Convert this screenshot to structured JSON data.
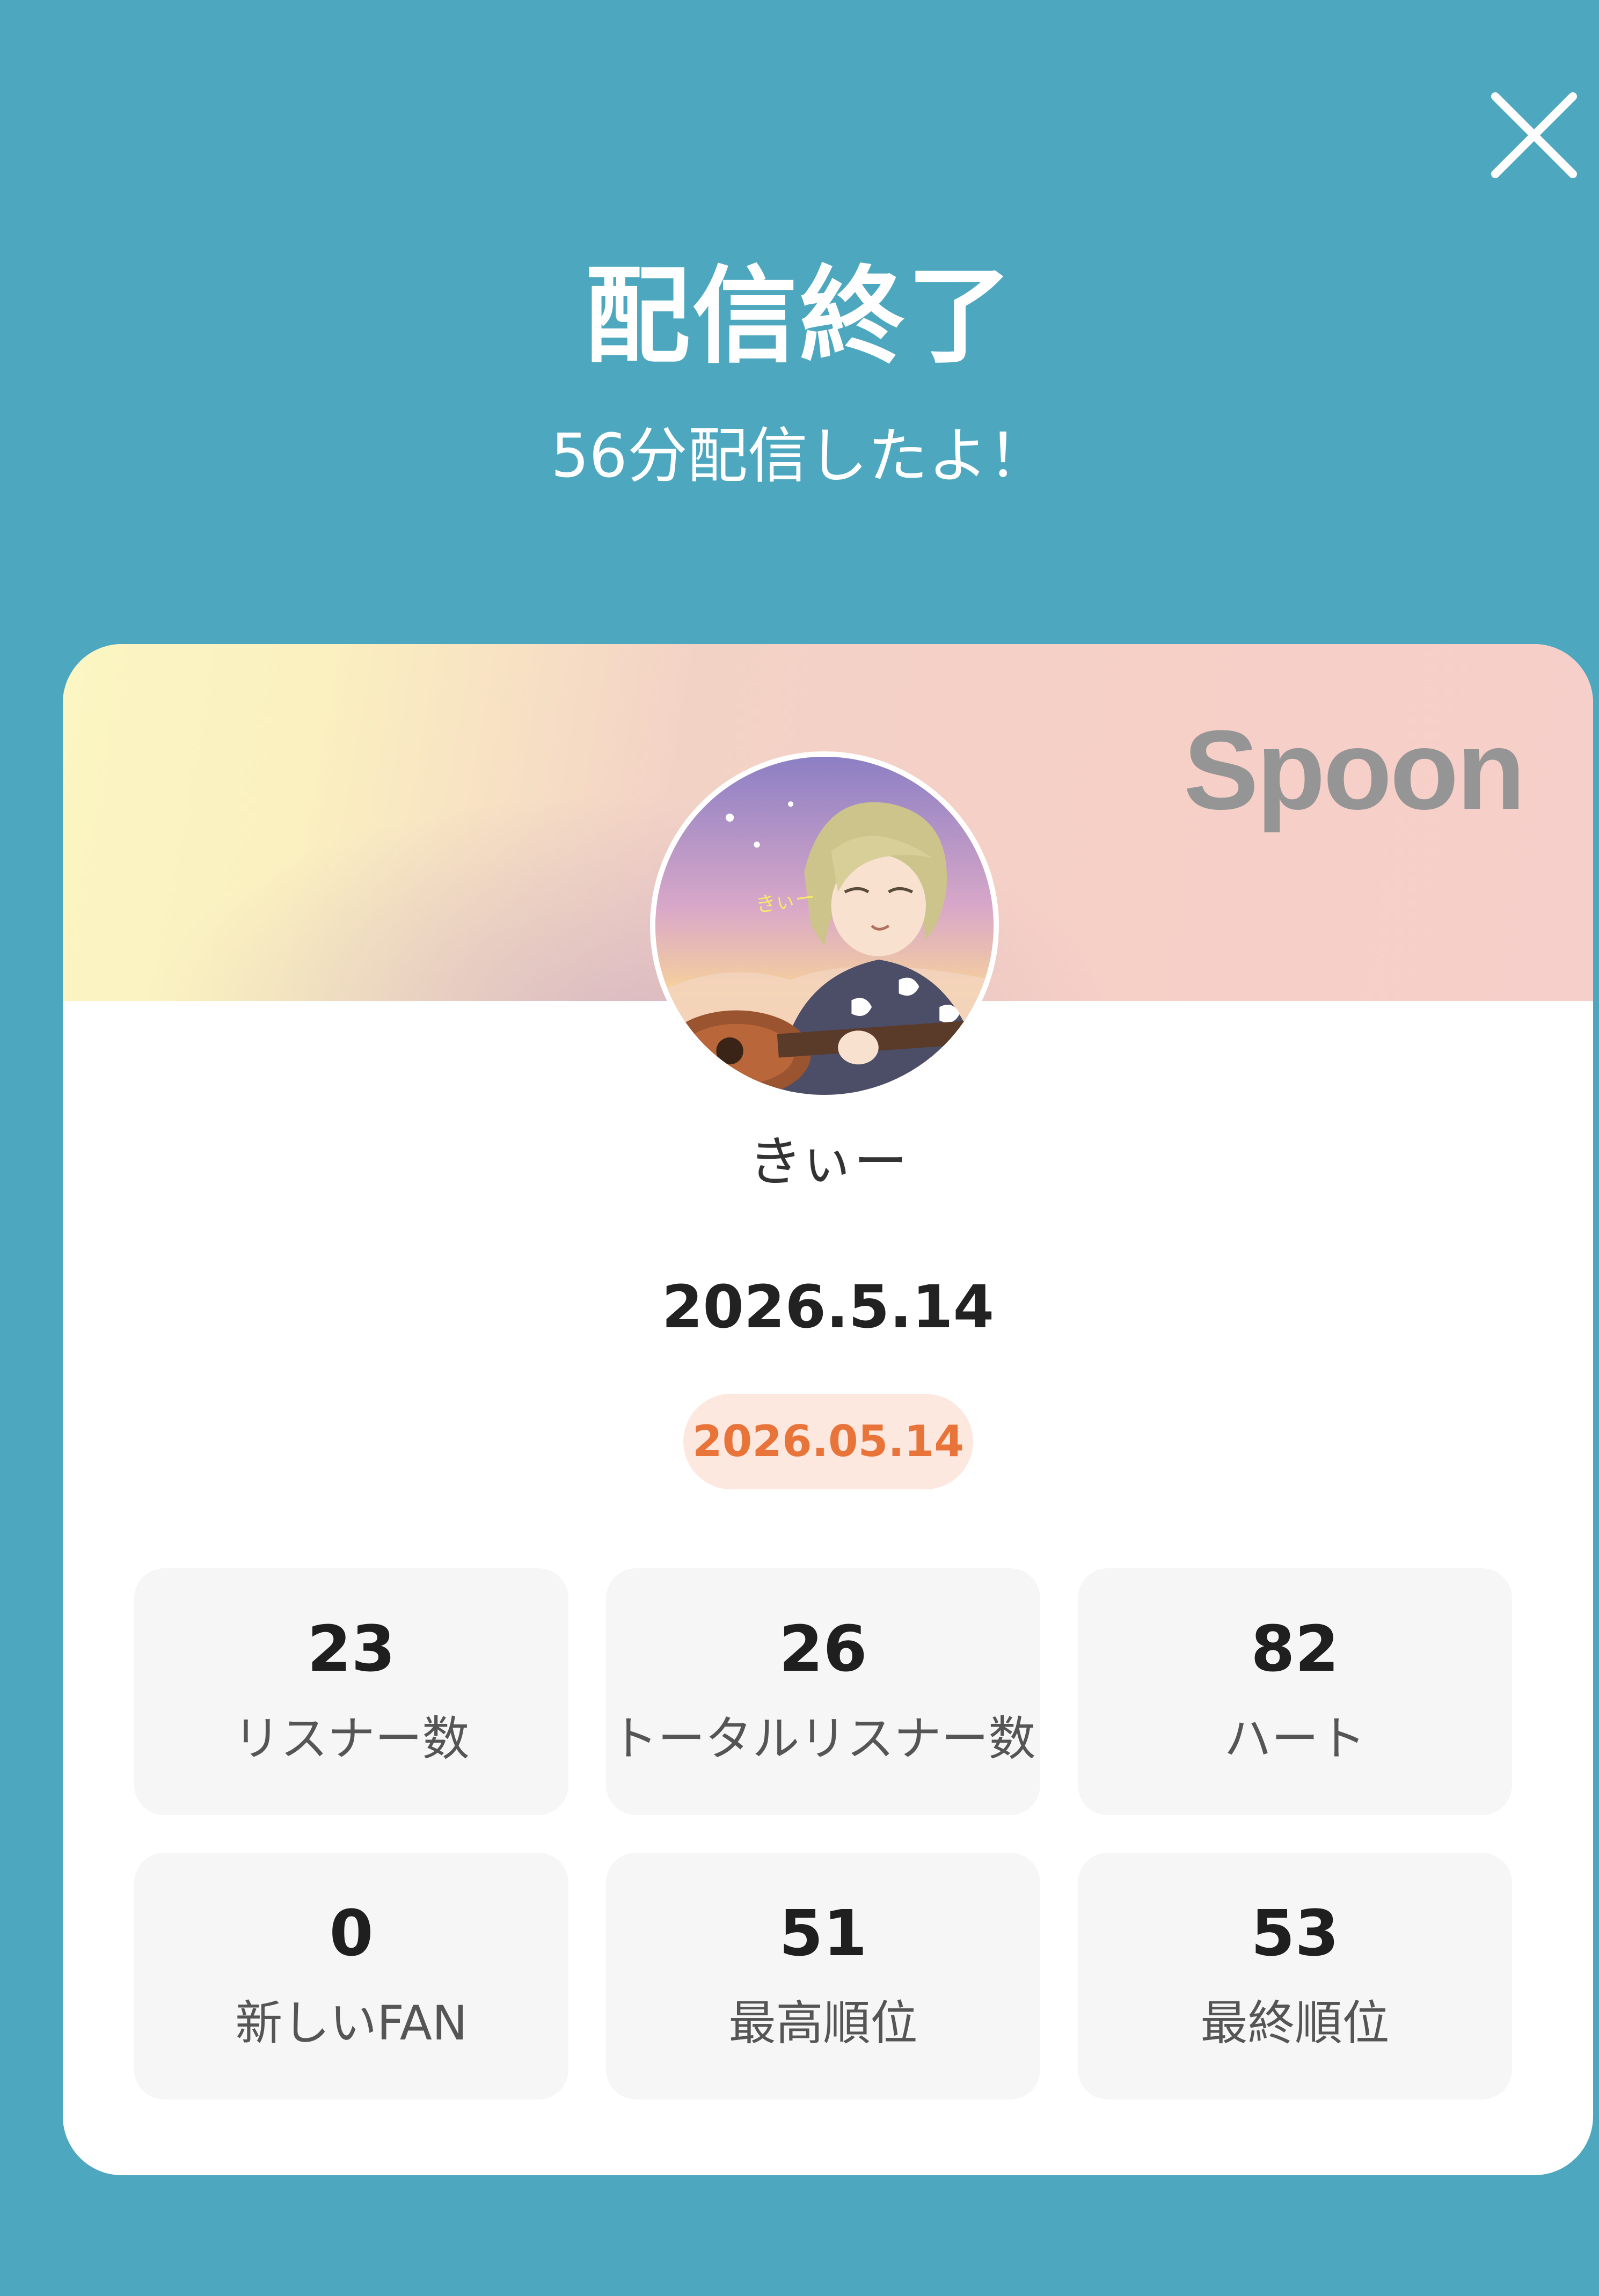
{
  "header": {
    "title": "配信終了",
    "subtitle": "56分配信したよ！"
  },
  "card": {
    "brand": "Spoon",
    "username": "きぃー",
    "date": "2026.5.14",
    "date_badge": "2026.05.14"
  },
  "stats": [
    {
      "value": "23",
      "label": "リスナー数"
    },
    {
      "value": "26",
      "label": "トータルリスナー数"
    },
    {
      "value": "82",
      "label": "ハート"
    },
    {
      "value": "0",
      "label": "新しいFAN"
    },
    {
      "value": "51",
      "label": "最高順位"
    },
    {
      "value": "53",
      "label": "最終順位"
    }
  ],
  "icons": {
    "close": "close-icon",
    "avatar": "avatar-image"
  },
  "colors": {
    "background": "#4da8bf",
    "card": "#ffffff",
    "badge_text": "#e8743a",
    "badge_bg": "#fde8df",
    "stat_bg": "#f6f6f6"
  }
}
